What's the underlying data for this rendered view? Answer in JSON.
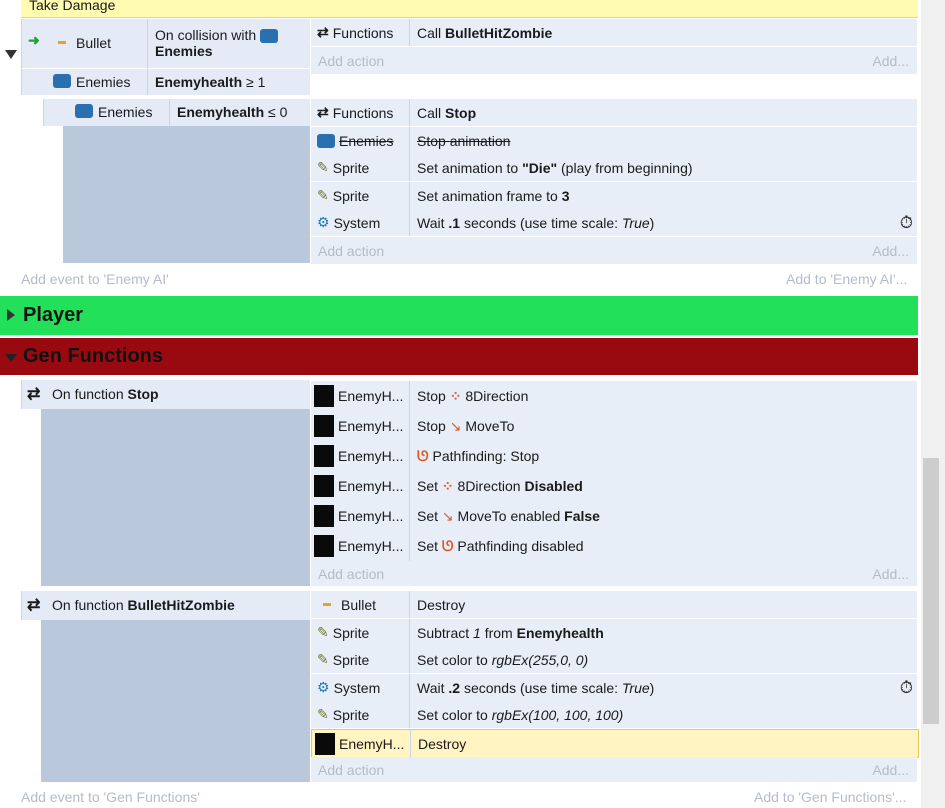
{
  "top_event": {
    "title": "Take Damage"
  },
  "event1": {
    "conditions": [
      {
        "object": "Bullet",
        "text_a": "On collision with",
        "text_b": "Enemies"
      },
      {
        "object": "Enemies",
        "text_a": "Enemyhealth",
        "text_b": "≥ 1"
      }
    ],
    "actions": [
      {
        "object": "Functions",
        "prefix": "Call",
        "value": "BulletHitZombie"
      }
    ],
    "add_action": "Add action",
    "add_right": "Add..."
  },
  "subevent": {
    "condition": {
      "object": "Enemies",
      "text_a": "Enemyhealth",
      "text_b": "≤ 0"
    },
    "actions": [
      {
        "object": "Functions",
        "text": "Call",
        "value": "Stop"
      },
      {
        "object": "Enemies",
        "text": "Stop animation"
      },
      {
        "object": "Sprite",
        "text": "Set animation to",
        "value": "\"Die\"",
        "suffix": "(play from beginning)"
      },
      {
        "object": "Sprite",
        "text": "Set animation frame to",
        "value": "3"
      },
      {
        "object": "System",
        "text": "Wait",
        "value": ".1",
        "suffix": "seconds (use time scale:",
        "italic": "True",
        "close": ")"
      }
    ],
    "add_action": "Add action",
    "add_right": "Add..."
  },
  "enemy_ai_footer": {
    "left": "Add event to 'Enemy AI'",
    "right": "Add to 'Enemy AI'..."
  },
  "groups": {
    "player": "Player",
    "gen_functions": "Gen Functions"
  },
  "colors": {
    "player": "#22e05a",
    "gen_functions": "#990a10"
  },
  "fn_stop": {
    "prefix": "On function",
    "name": "Stop",
    "actions": [
      {
        "object": "EnemyH...",
        "verb": "Stop",
        "behavior": "8Direction",
        "icon": "8direction-icon"
      },
      {
        "object": "EnemyH...",
        "verb": "Stop",
        "behavior": "MoveTo",
        "icon": "moveto-icon"
      },
      {
        "object": "EnemyH...",
        "verb": "Pathfinding: Stop",
        "icon": "pathfinding-icon"
      },
      {
        "object": "EnemyH...",
        "verb": "Set",
        "behavior": "8Direction",
        "state": "Disabled",
        "icon": "8direction-icon"
      },
      {
        "object": "EnemyH...",
        "verb": "Set",
        "behavior": "MoveTo enabled",
        "state": "False",
        "icon": "moveto-icon"
      },
      {
        "object": "EnemyH...",
        "verb": "Set",
        "behavior": "Pathfinding disabled",
        "icon": "pathfinding-icon"
      }
    ],
    "add_action": "Add action",
    "add_right": "Add..."
  },
  "fn_bullet": {
    "prefix": "On function",
    "name": "BulletHitZombie",
    "actions": [
      {
        "object": "Bullet",
        "text": "Destroy"
      },
      {
        "object": "Sprite",
        "text": "Subtract",
        "ital": "1",
        "mid": "from",
        "value": "Enemyhealth"
      },
      {
        "object": "Sprite",
        "text": "Set color to",
        "ital": "rgbEx(255,0, 0)"
      },
      {
        "object": "System",
        "text": "Wait",
        "value": ".2",
        "suffix": "seconds (use time scale:",
        "ital": "True",
        "close": ")"
      },
      {
        "object": "Sprite",
        "text": "Set color to",
        "ital": "rgbEx(100, 100, 100)"
      },
      {
        "object": "EnemyH...",
        "text": "Destroy"
      }
    ],
    "add_action": "Add action",
    "add_right": "Add..."
  },
  "gen_footer": {
    "left": "Add event to 'Gen Functions'",
    "right": "Add to 'Gen Functions'..."
  }
}
